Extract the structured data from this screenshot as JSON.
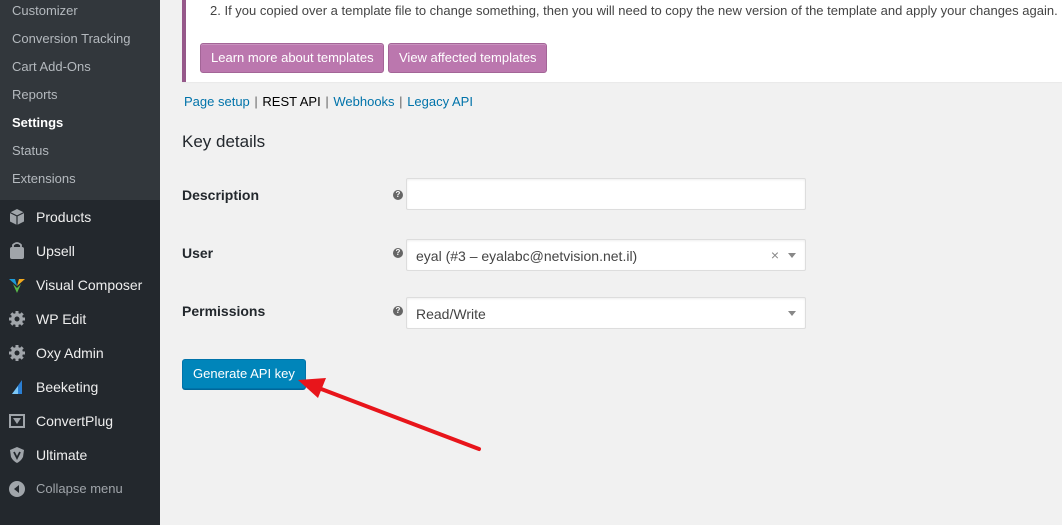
{
  "sidebar": {
    "submenu": [
      {
        "label": "Customizer",
        "current": false
      },
      {
        "label": "Conversion Tracking",
        "current": false
      },
      {
        "label": "Cart Add-Ons",
        "current": false
      },
      {
        "label": "Reports",
        "current": false
      },
      {
        "label": "Settings",
        "current": true
      },
      {
        "label": "Status",
        "current": false
      },
      {
        "label": "Extensions",
        "current": false
      }
    ],
    "menu": [
      {
        "label": "Products",
        "icon": "products-icon"
      },
      {
        "label": "Upsell",
        "icon": "upsell-icon"
      },
      {
        "label": "Visual Composer",
        "icon": "visual-composer-icon"
      },
      {
        "label": "WP Edit",
        "icon": "gear-icon"
      },
      {
        "label": "Oxy Admin",
        "icon": "gear-icon"
      },
      {
        "label": "Beeketing",
        "icon": "beeketing-icon"
      },
      {
        "label": "ConvertPlug",
        "icon": "convertplug-icon"
      },
      {
        "label": "Ultimate",
        "icon": "shield-icon"
      }
    ],
    "collapse_label": "Collapse menu"
  },
  "notice": {
    "text": "2. If you copied over a template file to change something, then you will need to copy the new version of the template and apply your changes again.",
    "learn_more_label": "Learn more about templates",
    "view_affected_label": "View affected templates"
  },
  "subnav": {
    "items": [
      "Page setup",
      "REST API",
      "Webhooks",
      "Legacy API"
    ],
    "current": "REST API",
    "separator": "|"
  },
  "form": {
    "heading": "Key details",
    "description": {
      "label": "Description",
      "value": ""
    },
    "user": {
      "label": "User",
      "value": "eyal (#3 – eyalabc@netvision.net.il)",
      "clear": "×"
    },
    "permissions": {
      "label": "Permissions",
      "value": "Read/Write"
    },
    "help_glyph": "?",
    "generate_label": "Generate API key"
  },
  "colors": {
    "sidebar_bg": "#23282d",
    "submenu_bg": "#32373c",
    "woo_purple": "#bb77ae",
    "primary_blue": "#0085ba",
    "annotation_red": "#e8151b"
  }
}
